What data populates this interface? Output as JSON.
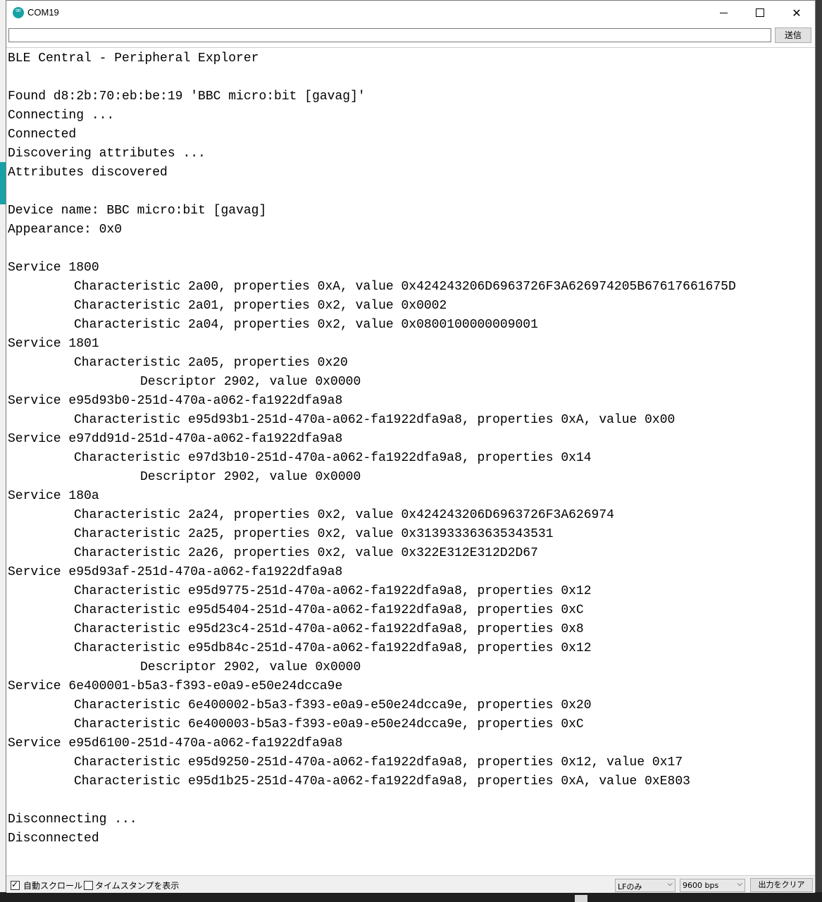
{
  "window": {
    "title": "COM19",
    "minimize_icon": "minimize-icon",
    "maximize_icon": "maximize-icon",
    "close_icon": "close-icon"
  },
  "send": {
    "input_value": "",
    "button_label": "送信"
  },
  "output_lines": [
    {
      "indent": 0,
      "text": "BLE Central - Peripheral Explorer"
    },
    {
      "indent": 0,
      "text": ""
    },
    {
      "indent": 0,
      "text": "Found d8:2b:70:eb:be:19 'BBC micro:bit [gavag]'"
    },
    {
      "indent": 0,
      "text": "Connecting ..."
    },
    {
      "indent": 0,
      "text": "Connected"
    },
    {
      "indent": 0,
      "text": "Discovering attributes ..."
    },
    {
      "indent": 0,
      "text": "Attributes discovered"
    },
    {
      "indent": 0,
      "text": ""
    },
    {
      "indent": 0,
      "text": "Device name: BBC micro:bit [gavag]"
    },
    {
      "indent": 0,
      "text": "Appearance: 0x0"
    },
    {
      "indent": 0,
      "text": ""
    },
    {
      "indent": 0,
      "text": "Service 1800"
    },
    {
      "indent": 1,
      "text": "Characteristic 2a00, properties 0xA, value 0x424243206D6963726F3A626974205B67617661675D"
    },
    {
      "indent": 1,
      "text": "Characteristic 2a01, properties 0x2, value 0x0002"
    },
    {
      "indent": 1,
      "text": "Characteristic 2a04, properties 0x2, value 0x0800100000009001"
    },
    {
      "indent": 0,
      "text": "Service 1801"
    },
    {
      "indent": 1,
      "text": "Characteristic 2a05, properties 0x20"
    },
    {
      "indent": 2,
      "text": "Descriptor 2902, value 0x0000"
    },
    {
      "indent": 0,
      "text": "Service e95d93b0-251d-470a-a062-fa1922dfa9a8"
    },
    {
      "indent": 1,
      "text": "Characteristic e95d93b1-251d-470a-a062-fa1922dfa9a8, properties 0xA, value 0x00"
    },
    {
      "indent": 0,
      "text": "Service e97dd91d-251d-470a-a062-fa1922dfa9a8"
    },
    {
      "indent": 1,
      "text": "Characteristic e97d3b10-251d-470a-a062-fa1922dfa9a8, properties 0x14"
    },
    {
      "indent": 2,
      "text": "Descriptor 2902, value 0x0000"
    },
    {
      "indent": 0,
      "text": "Service 180a"
    },
    {
      "indent": 1,
      "text": "Characteristic 2a24, properties 0x2, value 0x424243206D6963726F3A626974"
    },
    {
      "indent": 1,
      "text": "Characteristic 2a25, properties 0x2, value 0x313933363635343531"
    },
    {
      "indent": 1,
      "text": "Characteristic 2a26, properties 0x2, value 0x322E312E312D2D67"
    },
    {
      "indent": 0,
      "text": "Service e95d93af-251d-470a-a062-fa1922dfa9a8"
    },
    {
      "indent": 1,
      "text": "Characteristic e95d9775-251d-470a-a062-fa1922dfa9a8, properties 0x12"
    },
    {
      "indent": 1,
      "text": "Characteristic e95d5404-251d-470a-a062-fa1922dfa9a8, properties 0xC"
    },
    {
      "indent": 1,
      "text": "Characteristic e95d23c4-251d-470a-a062-fa1922dfa9a8, properties 0x8"
    },
    {
      "indent": 1,
      "text": "Characteristic e95db84c-251d-470a-a062-fa1922dfa9a8, properties 0x12"
    },
    {
      "indent": 2,
      "text": "Descriptor 2902, value 0x0000"
    },
    {
      "indent": 0,
      "text": "Service 6e400001-b5a3-f393-e0a9-e50e24dcca9e"
    },
    {
      "indent": 1,
      "text": "Characteristic 6e400002-b5a3-f393-e0a9-e50e24dcca9e, properties 0x20"
    },
    {
      "indent": 1,
      "text": "Characteristic 6e400003-b5a3-f393-e0a9-e50e24dcca9e, properties 0xC"
    },
    {
      "indent": 0,
      "text": "Service e95d6100-251d-470a-a062-fa1922dfa9a8"
    },
    {
      "indent": 1,
      "text": "Characteristic e95d9250-251d-470a-a062-fa1922dfa9a8, properties 0x12, value 0x17"
    },
    {
      "indent": 1,
      "text": "Characteristic e95d1b25-251d-470a-a062-fa1922dfa9a8, properties 0xA, value 0xE803"
    },
    {
      "indent": 0,
      "text": ""
    },
    {
      "indent": 0,
      "text": "Disconnecting ..."
    },
    {
      "indent": 0,
      "text": "Disconnected"
    }
  ],
  "footer": {
    "autoscroll_label": "自動スクロール",
    "autoscroll_checked": true,
    "timestamp_label": "タイムスタンプを表示",
    "timestamp_checked": false,
    "line_ending": "LFのみ",
    "baud_rate": "9600 bps",
    "clear_label": "出力をクリア"
  },
  "colors": {
    "accent": "#17a1a5"
  }
}
